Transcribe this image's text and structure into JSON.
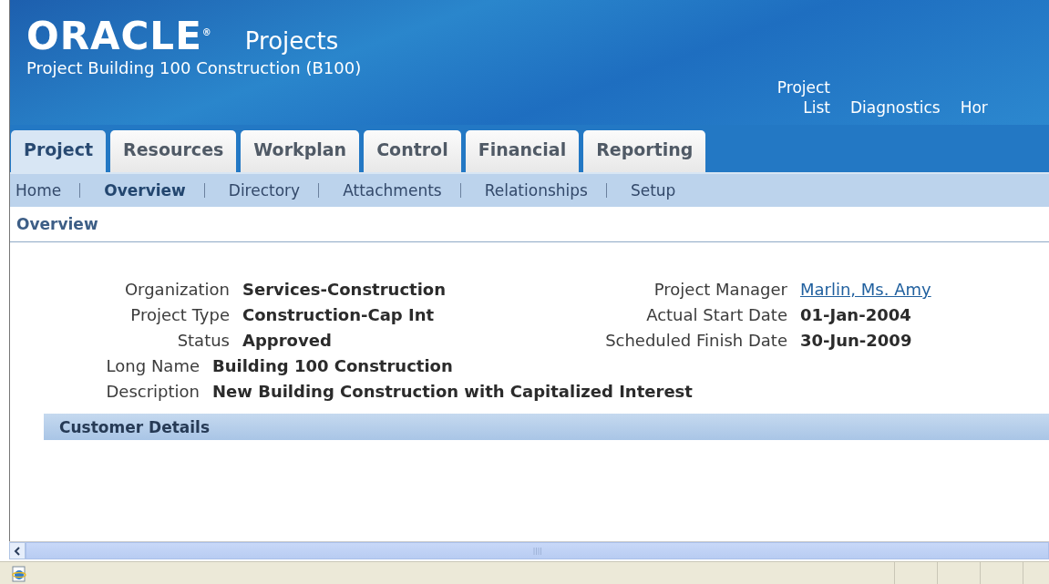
{
  "header": {
    "logo": "ORACLE$^{®}$",
    "app_name": "Projects",
    "project_title": "Project Building 100 Construction (B100)",
    "global_links": [
      "Project List",
      "Diagnostics",
      "Hor"
    ]
  },
  "tabs": [
    {
      "label": "Project",
      "selected": true
    },
    {
      "label": "Resources",
      "selected": false
    },
    {
      "label": "Workplan",
      "selected": false
    },
    {
      "label": "Control",
      "selected": false
    },
    {
      "label": "Financial",
      "selected": false
    },
    {
      "label": "Reporting",
      "selected": false
    }
  ],
  "subtabs": [
    {
      "label": "Home",
      "selected": false
    },
    {
      "label": "Overview",
      "selected": true
    },
    {
      "label": "Directory",
      "selected": false
    },
    {
      "label": "Attachments",
      "selected": false
    },
    {
      "label": "Relationships",
      "selected": false
    },
    {
      "label": "Setup",
      "selected": false
    }
  ],
  "page_title": "Overview",
  "fields_left": [
    {
      "label": "Organization",
      "value": "Services-Construction",
      "kind": "text"
    },
    {
      "label": "Project Type",
      "value": "Construction-Cap Int",
      "kind": "text"
    },
    {
      "label": "Status",
      "value": "Approved",
      "kind": "text"
    }
  ],
  "fields_right": [
    {
      "label": "Project Manager",
      "value": "Marlin, Ms. Amy",
      "kind": "link"
    },
    {
      "label": "Actual Start Date",
      "value": "01-Jan-2004",
      "kind": "text"
    },
    {
      "label": "Scheduled Finish Date",
      "value": "30-Jun-2009",
      "kind": "text"
    }
  ],
  "fields_wide": [
    {
      "label": "Long Name",
      "value": "Building 100 Construction",
      "kind": "text"
    },
    {
      "label": "Description",
      "value": "New Building Construction with Capitalized Interest",
      "kind": "text"
    }
  ],
  "section_header": "Customer Details"
}
